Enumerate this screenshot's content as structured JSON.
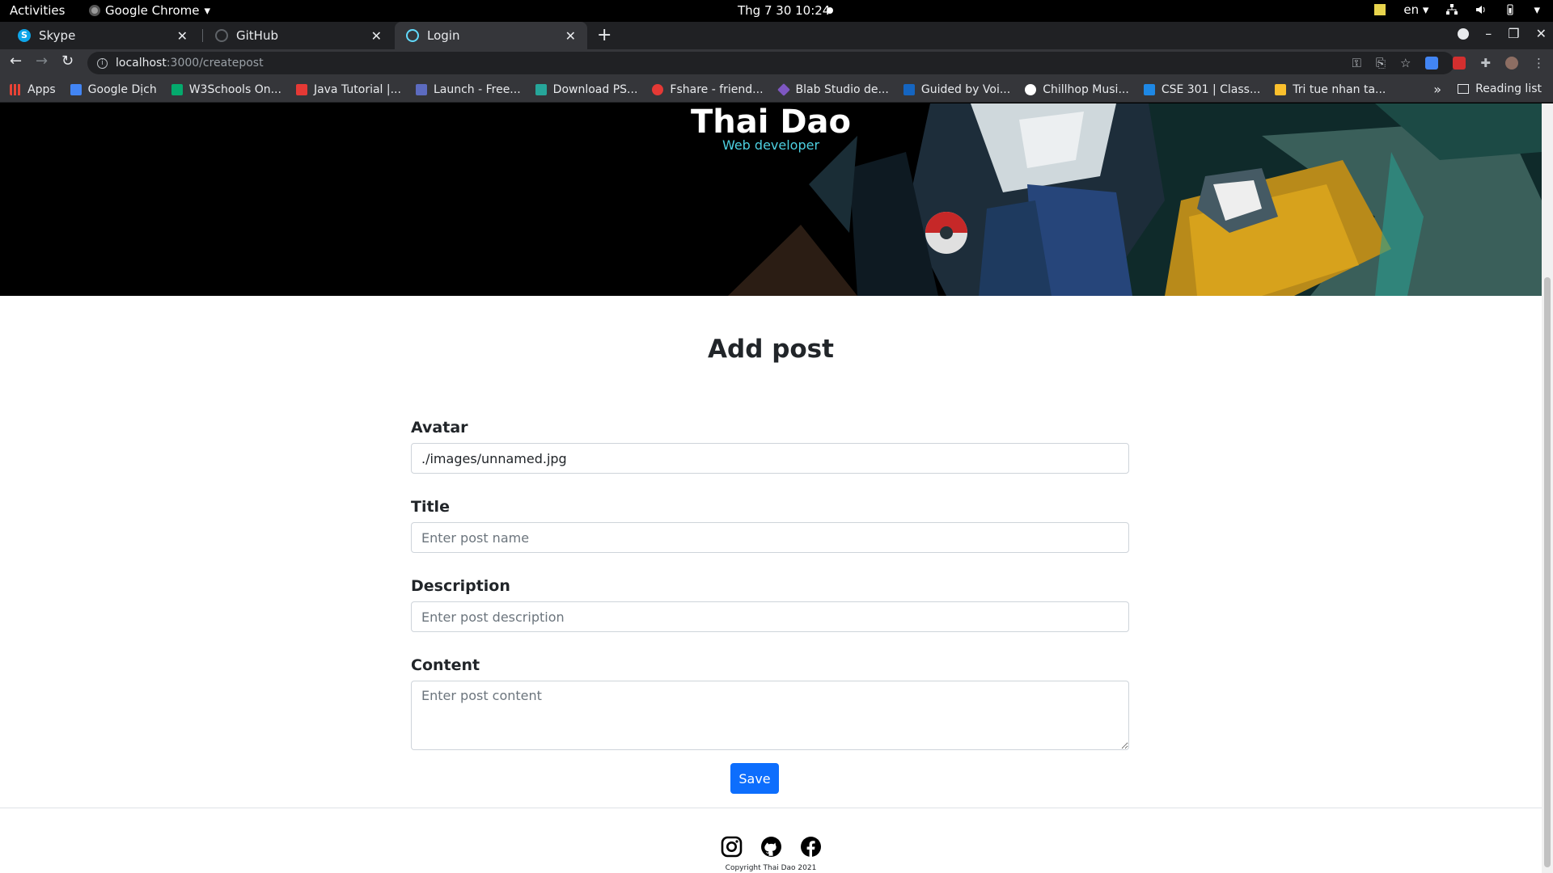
{
  "system": {
    "activities": "Activities",
    "app_name": "Google Chrome",
    "clock": "Thg 7 30  10:24",
    "language": "en"
  },
  "tabs": [
    {
      "title": "Skype",
      "icon": "skype-icon",
      "active": false
    },
    {
      "title": "GitHub",
      "icon": "github-icon",
      "active": false
    },
    {
      "title": "Login",
      "icon": "react-icon",
      "active": true
    }
  ],
  "address_bar": {
    "host": "localhost",
    "path": ":3000/createpost"
  },
  "bookmarks": [
    {
      "label": "Apps",
      "icon": "apps-grid-icon",
      "color": "#ea4335"
    },
    {
      "label": "Google Dịch",
      "icon": "google-translate-icon",
      "color": "#4285f4"
    },
    {
      "label": "W3Schools On...",
      "icon": "w3schools-icon",
      "color": "#04aa6d"
    },
    {
      "label": "Java Tutorial |...",
      "icon": "java-icon",
      "color": "#e53935"
    },
    {
      "label": "Launch - Free...",
      "icon": "w3-icon",
      "color": "#5c6bc0"
    },
    {
      "label": "Download PS...",
      "icon": "ae-icon",
      "color": "#26a69a"
    },
    {
      "label": "Fshare - friend...",
      "icon": "fshare-icon",
      "color": "#e53935"
    },
    {
      "label": "Blab Studio de...",
      "icon": "blab-icon",
      "color": "#7e57c2"
    },
    {
      "label": "Guided by Voi...",
      "icon": "guided-icon",
      "color": "#1565c0"
    },
    {
      "label": "Chillhop Musi...",
      "icon": "chillhop-icon",
      "color": "#ffffff"
    },
    {
      "label": "CSE 301 | Class...",
      "icon": "cse-icon",
      "color": "#1e88e5"
    },
    {
      "label": "Tri tue nhan ta...",
      "icon": "folder-icon",
      "color": "#fbc02d"
    }
  ],
  "reading_list": "Reading list",
  "hero": {
    "name": "Thai Dao",
    "role": "Web developer"
  },
  "form": {
    "title": "Add post",
    "avatar_label": "Avatar",
    "avatar_value": "./images/unnamed.jpg",
    "title_label": "Title",
    "title_placeholder": "Enter post name",
    "description_label": "Description",
    "description_placeholder": "Enter post description",
    "content_label": "Content",
    "content_placeholder": "Enter post content",
    "save_label": "Save"
  },
  "footer": {
    "icons": [
      "instagram-icon",
      "github-icon",
      "facebook-icon"
    ],
    "copyright": "Copyright Thai Dao 2021"
  },
  "colors": {
    "accent": "#0d6efd",
    "hero_subtitle": "#4dd0e1"
  }
}
